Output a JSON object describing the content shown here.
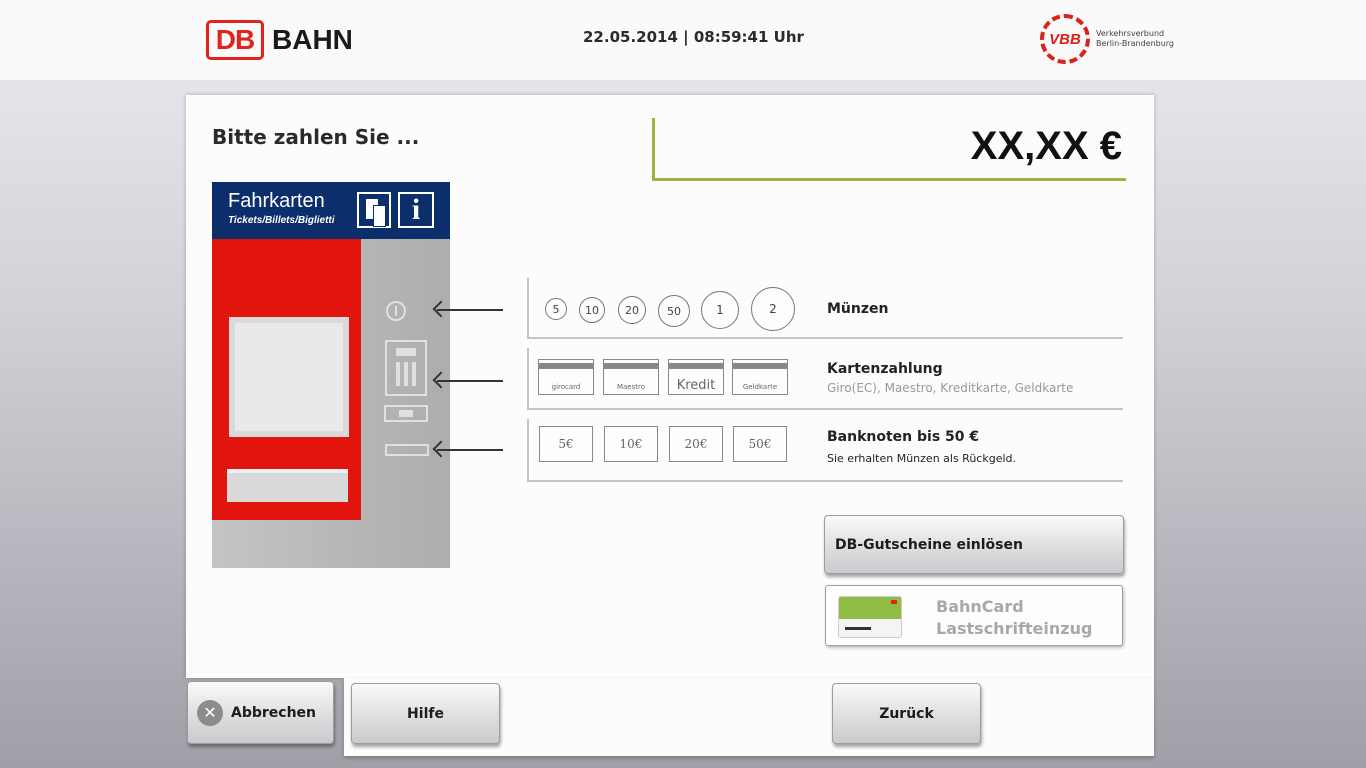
{
  "header": {
    "db_logo": "DB",
    "brand": "BAHN",
    "datetime": "22.05.2014 | 08:59:41 Uhr",
    "vbb_logo": "VBB",
    "vbb_text": "Verkehrsverbund Berlin-Brandenburg"
  },
  "main": {
    "prompt": "Bitte zahlen Sie ...",
    "price": "XX,XX €"
  },
  "machine": {
    "title": "Fahrkarten",
    "subtitle": "Tickets/Billets/Biglietti",
    "info_icon": "i"
  },
  "payment": {
    "coins": {
      "values": [
        "5",
        "10",
        "20",
        "50",
        "1",
        "2"
      ],
      "title": "Münzen"
    },
    "cards": {
      "items": [
        "girocard",
        "Maestro",
        "Kredit",
        "Geldkarte"
      ],
      "title": "Kartenzahlung",
      "subtitle": "Giro(EC), Maestro, Kreditkarte, Geldkarte"
    },
    "notes": {
      "items": [
        "5€",
        "10€",
        "20€",
        "50€"
      ],
      "title": "Banknoten bis 50 €",
      "subtitle": "Sie erhalten Münzen als Rückgeld."
    }
  },
  "buttons": {
    "gutschein": "DB-Gutscheine einlösen",
    "bahncard_line1": "BahnCard",
    "bahncard_line2": "Lastschrifteinzug",
    "abbrechen": "Abbrechen",
    "abbrechen_icon": "✕",
    "hilfe": "Hilfe",
    "zurueck": "Zurück"
  },
  "colors": {
    "db_red": "#e2221c",
    "machine_blue": "#0c2f6b",
    "price_accent": "#9ab642"
  }
}
